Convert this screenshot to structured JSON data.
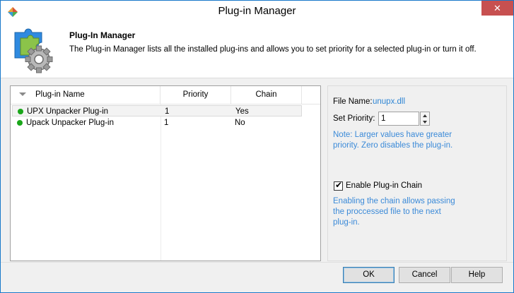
{
  "window": {
    "title": "Plug-in Manager",
    "close_glyph": "✕"
  },
  "header": {
    "title": "Plug-In Manager",
    "description": "The Plug-in Manager lists all the installed plug-ins and allows you to set priority for a selected plug-in or turn it off."
  },
  "list": {
    "columns": [
      "Plug-in Name",
      "Priority",
      "Chain"
    ],
    "rows": [
      {
        "name": "UPX Unpacker Plug-in",
        "priority": "1",
        "chain": "Yes",
        "status": "enabled",
        "selected": true
      },
      {
        "name": "Upack Unpacker Plug-in",
        "priority": "1",
        "chain": "No",
        "status": "enabled",
        "selected": false
      }
    ]
  },
  "props": {
    "file_name_label": "File Name:",
    "file_name_value": "unupx.dll",
    "priority_label": "Set Priority:",
    "priority_value": "1",
    "priority_note_1": "Note: Larger values have greater",
    "priority_note_2": "priority. Zero disables the plug-in.",
    "chain_checkbox_label": "Enable Plug-in Chain",
    "chain_checked": true,
    "chain_note_1": "Enabling the chain allows passing",
    "chain_note_2": "the proccessed file to the next",
    "chain_note_3": "plug-in."
  },
  "footer": {
    "ok": "OK",
    "cancel": "Cancel",
    "help": "Help"
  },
  "colors": {
    "accent": "#1979ca",
    "link": "#2f86d4",
    "status_green": "#1aa61a",
    "close_red": "#c75050"
  }
}
